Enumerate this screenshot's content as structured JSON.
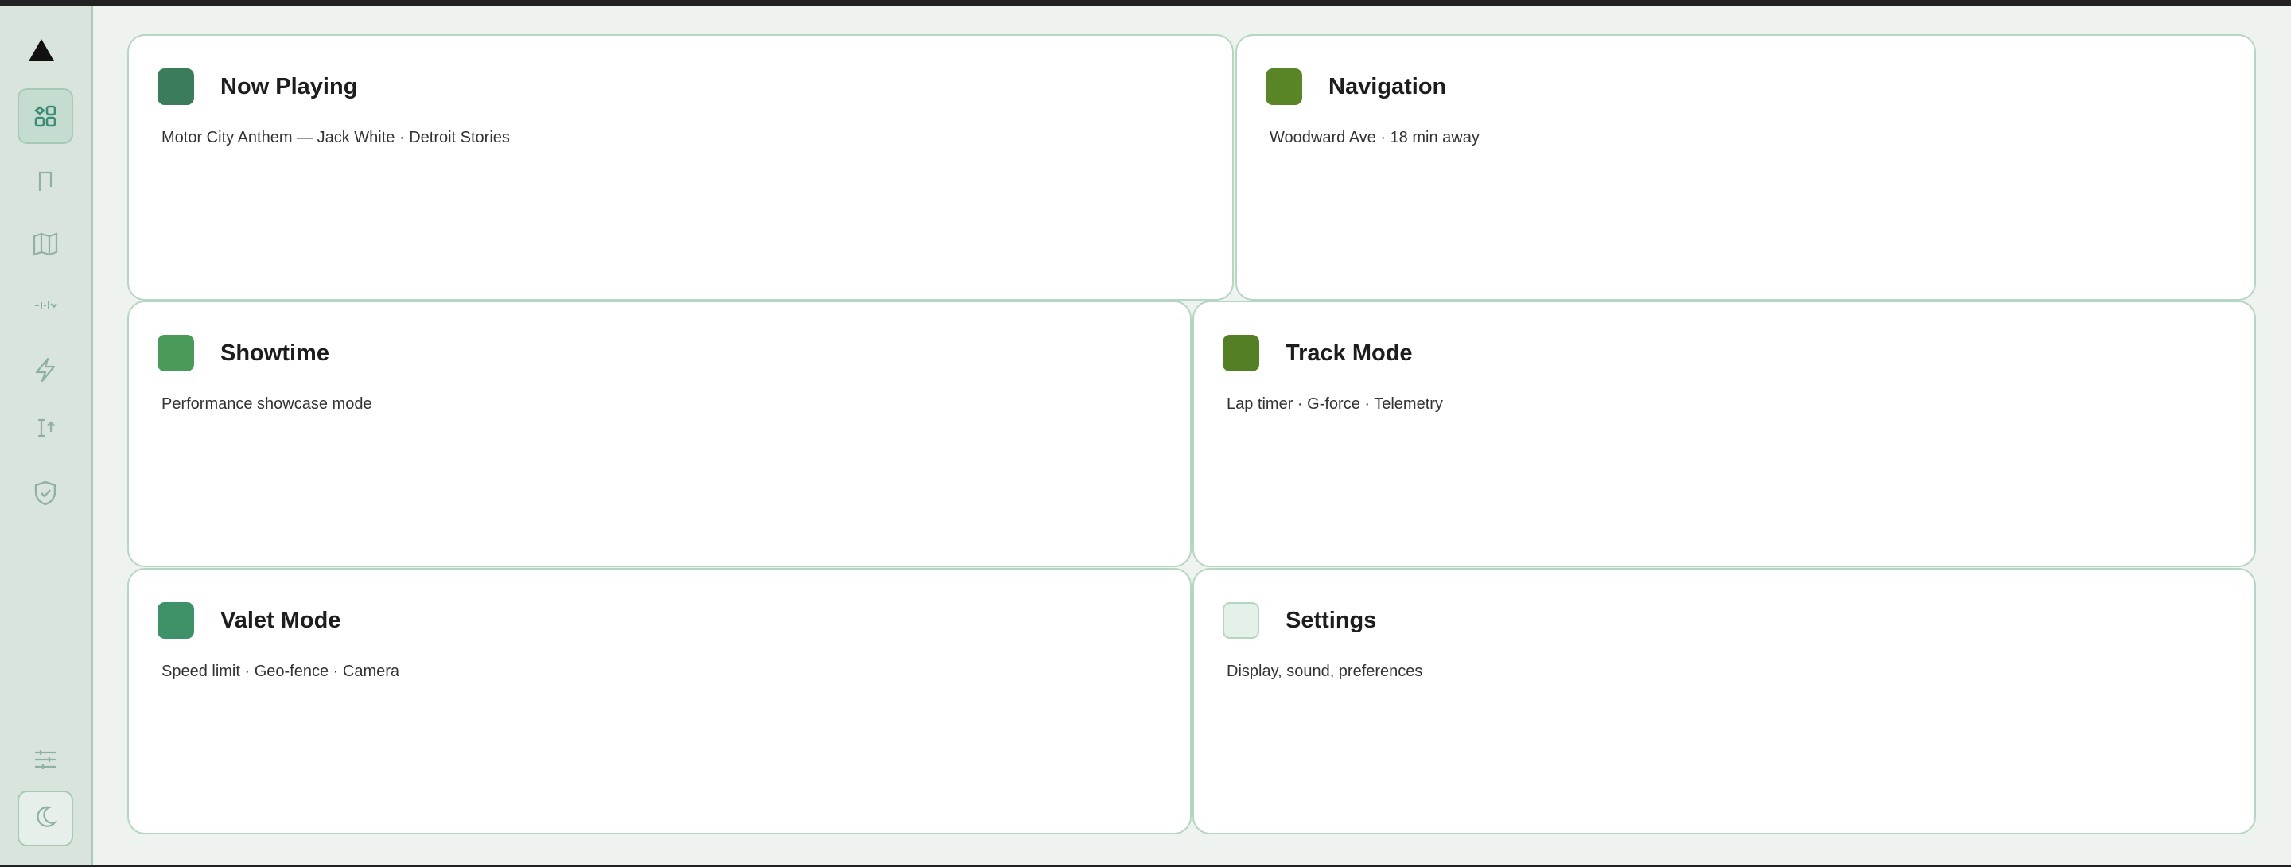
{
  "colors": {
    "background": "#eef3ef",
    "sidebar": "#d9e4dd",
    "card_border": "#b5d6c1",
    "icon": "#5a8f7c",
    "active_icon": "#3d8a75"
  },
  "sidebar": {
    "logo": "triangle-logo",
    "items": [
      {
        "icon": "grid-icon",
        "active": true
      },
      {
        "icon": "flag-icon",
        "active": false
      },
      {
        "icon": "map-icon",
        "active": false
      },
      {
        "icon": "tuning-icon",
        "active": false
      },
      {
        "icon": "lightning-icon",
        "active": false
      },
      {
        "icon": "measure-icon",
        "active": false
      },
      {
        "icon": "shield-icon",
        "active": false
      }
    ],
    "bottom": [
      {
        "icon": "sliders-icon"
      },
      {
        "icon": "moon-icon"
      }
    ]
  },
  "cards": [
    {
      "title": "Now Playing",
      "desc": "Motor City Anthem — Jack White · Detroit Stories",
      "color": "#3b7d5a"
    },
    {
      "title": "Navigation",
      "desc": "Woodward Ave · 18 min away",
      "color": "#5a8527"
    },
    {
      "title": "Showtime",
      "desc": "Performance showcase mode",
      "color": "#4a9a5a"
    },
    {
      "title": "Track Mode",
      "desc": "Lap timer · G-force · Telemetry",
      "color": "#557f25"
    },
    {
      "title": "Valet Mode",
      "desc": "Speed limit · Geo-fence · Camera",
      "color": "#3f9168"
    },
    {
      "title": "Settings",
      "desc": "Display, sound, preferences",
      "color": "#e3f1e8"
    }
  ]
}
